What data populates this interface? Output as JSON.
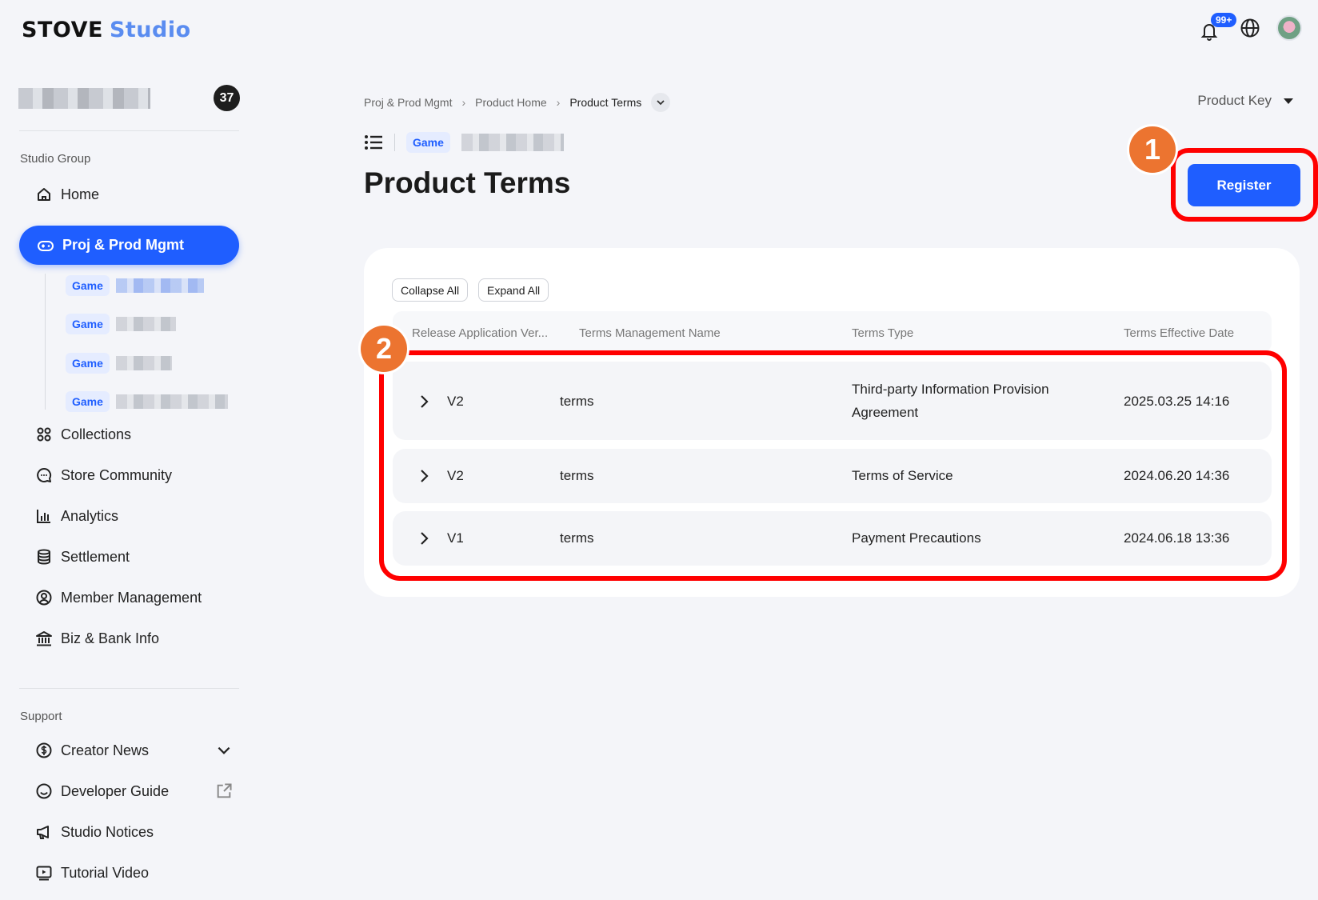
{
  "header": {
    "logo_primary": "STOVE",
    "logo_secondary": "Studio",
    "notifications_badge": "99+",
    "icons": [
      "bell-icon",
      "globe-icon",
      "avatar"
    ]
  },
  "sidebar": {
    "member_count": "37",
    "studio_group_label": "Studio Group",
    "items": [
      {
        "label": "Home",
        "icon": "home-icon"
      },
      {
        "label": "Proj & Prod Mgmt",
        "icon": "controller-icon",
        "active": true
      },
      {
        "label": "Collections",
        "icon": "grid-icon"
      },
      {
        "label": "Store Community",
        "icon": "chat-icon"
      },
      {
        "label": "Analytics",
        "icon": "chart-icon"
      },
      {
        "label": "Settlement",
        "icon": "database-icon"
      },
      {
        "label": "Member Management",
        "icon": "user-circle-icon"
      },
      {
        "label": "Biz & Bank Info",
        "icon": "bank-icon"
      }
    ],
    "games": [
      {
        "tag": "Game"
      },
      {
        "tag": "Game"
      },
      {
        "tag": "Game"
      },
      {
        "tag": "Game"
      }
    ],
    "support_label": "Support",
    "support_items": [
      {
        "label": "Creator News",
        "icon": "dollar-circle-icon",
        "trailing": "chevron-down-icon"
      },
      {
        "label": "Developer Guide",
        "icon": "smile-icon",
        "trailing": "external-link-icon"
      },
      {
        "label": "Studio Notices",
        "icon": "megaphone-icon"
      },
      {
        "label": "Tutorial Video",
        "icon": "play-icon"
      }
    ]
  },
  "main": {
    "breadcrumb": [
      "Proj & Prod Mgmt",
      "Product Home",
      "Product Terms"
    ],
    "product_key_label": "Product Key",
    "game_tag": "Game",
    "page_title": "Product Terms",
    "register_label": "Register",
    "step_1": "1",
    "step_2": "2",
    "collapse_all_label": "Collapse All",
    "expand_all_label": "Expand All",
    "table": {
      "columns": [
        "Release Application Ver...",
        "Terms Management Name",
        "Terms Type",
        "Terms Effective Date"
      ],
      "rows": [
        {
          "version": "V2",
          "name": "terms",
          "type_line1": "Third-party Information Provision",
          "type_line2": "Agreement",
          "date": "2025.03.25 14:16"
        },
        {
          "version": "V2",
          "name": "terms",
          "type_line1": "Terms of Service",
          "type_line2": "",
          "date": "2024.06.20 14:36"
        },
        {
          "version": "V1",
          "name": "terms",
          "type_line1": "Payment Precautions",
          "type_line2": "",
          "date": "2024.06.18 13:36"
        }
      ]
    }
  },
  "colors": {
    "accent": "#1f5eff",
    "highlight": "#ff0000",
    "step_badge": "#ec7430"
  }
}
